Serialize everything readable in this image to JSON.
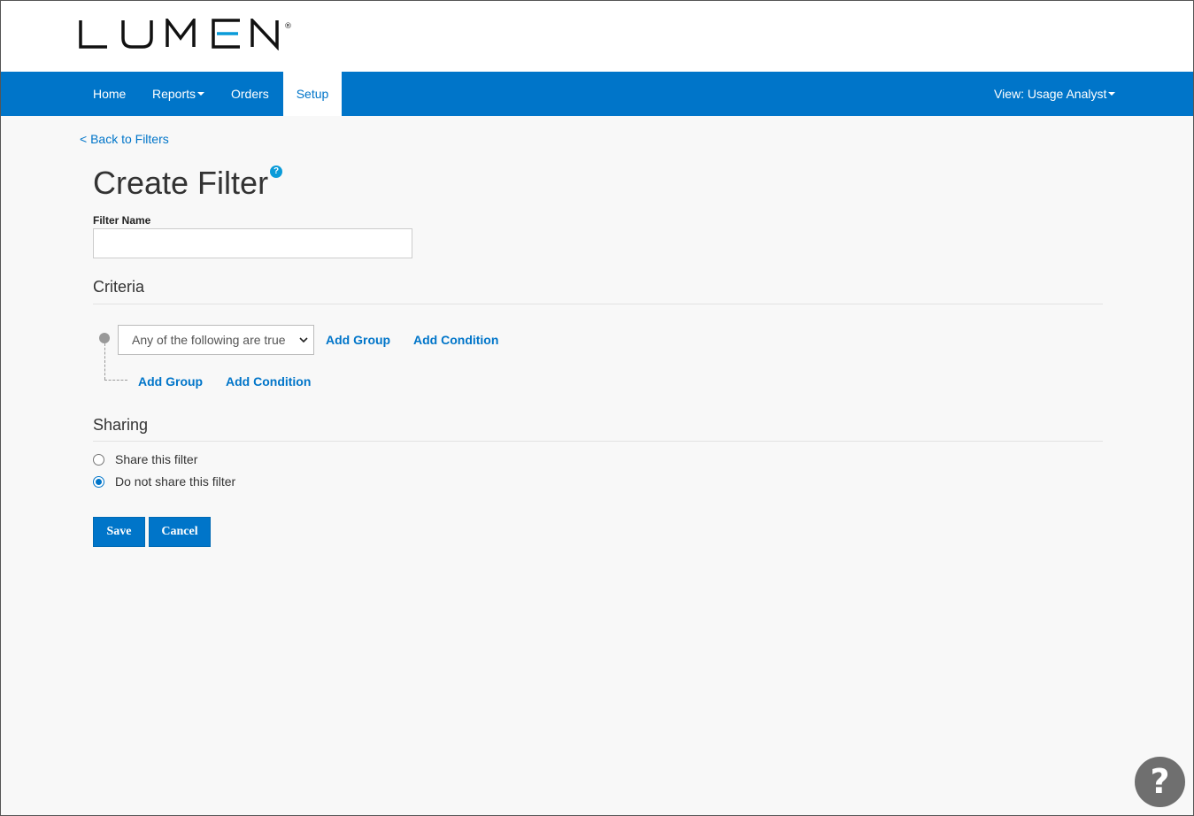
{
  "brand": {
    "name": "LUMEN",
    "registered_mark": "®"
  },
  "nav": {
    "items": [
      {
        "label": "Home"
      },
      {
        "label": "Reports"
      },
      {
        "label": "Orders"
      },
      {
        "label": "Setup"
      }
    ],
    "view_label": "View: Usage Analyst"
  },
  "back_link": "< Back to Filters",
  "page_title": "Create Filter",
  "help_badge": "?",
  "filter_name": {
    "label": "Filter Name",
    "value": "",
    "placeholder": ""
  },
  "criteria": {
    "title": "Criteria",
    "select_value": "Any of the following are true",
    "add_group": "Add Group",
    "add_condition": "Add Condition",
    "sub_add_group": "Add Group",
    "sub_add_condition": "Add Condition"
  },
  "sharing": {
    "title": "Sharing",
    "options": [
      {
        "label": "Share this filter",
        "selected": false
      },
      {
        "label": "Do not share this filter",
        "selected": true
      }
    ]
  },
  "buttons": {
    "save": "Save",
    "cancel": "Cancel"
  },
  "help_fab": "?",
  "colors": {
    "accent": "#0075c9",
    "background": "#f8f8f8"
  }
}
